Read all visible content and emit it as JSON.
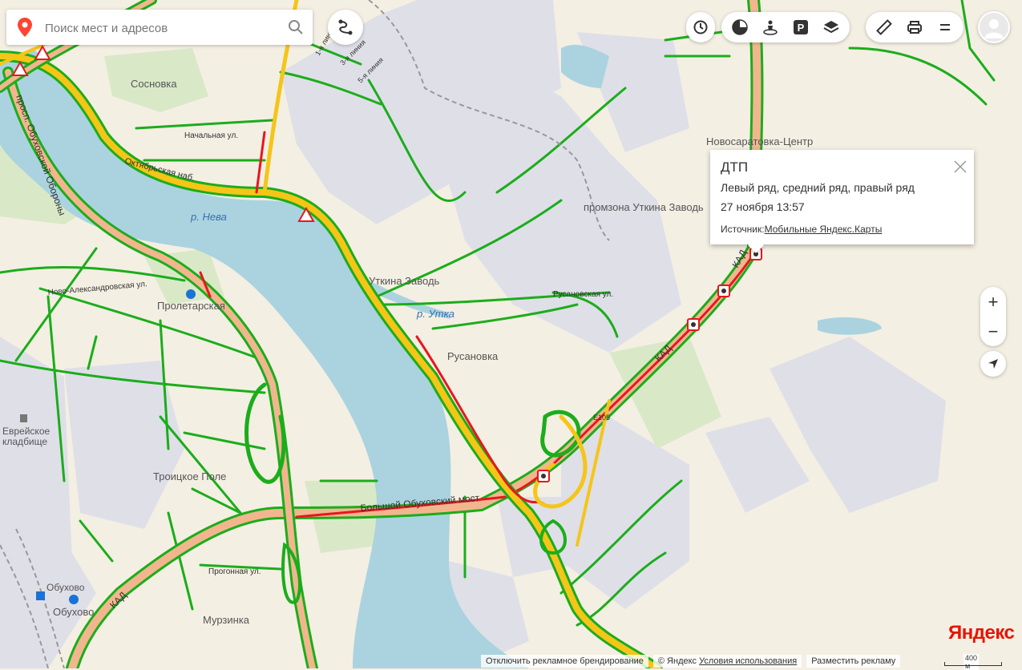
{
  "search": {
    "placeholder": "Поиск мест и адресов"
  },
  "labels": {
    "sosnovka": "Сосновка",
    "oktyabrskaya": "Октябрьская наб.",
    "neva": "р. Нева",
    "obukhovskoy": "просп. Обуховской Обороны",
    "proletarskaya": "Пролетарская",
    "novoalexandr": "Ново-Александровская ул.",
    "utkina": "Уткина Заводь",
    "utka": "р. Утка",
    "rusanovka": "Русановка",
    "promzona": "промзона Уткина Заводь",
    "novosaratovka": "Новосаратовка-Центр",
    "evreyskoe1": "Еврейское",
    "evreyskoe2": "кладбище",
    "troitskoe": "Троицкое Поле",
    "bolshoy": "Большой Обуховский мост",
    "kad": "КАД",
    "obukhovo": "Обухово",
    "murzinka": "Мурзинка",
    "progonnaya": "Прогонная ул.",
    "liniya1": "1-я линия",
    "liniya3": "3-я линия",
    "liniya5": "5-я линия",
    "rusanovskaya": "Русановская ул.",
    "e105": "E105",
    "ulitsa_nav": "Начальная ул."
  },
  "popup": {
    "title": "ДТП",
    "lanes": "Левый ряд, средний ряд, правый ряд",
    "datetime": "27 ноября 13:57",
    "source_label": "Источник:",
    "source_link": "Мобильные Яндекс.Карты"
  },
  "zoom": {
    "in": "+",
    "out": "−"
  },
  "logo": "Яндекс",
  "footer": {
    "branding": "Отключить рекламное брендирование",
    "copyright": "© Яндекс",
    "terms": "Условия использования",
    "ads": "Разместить рекламу"
  },
  "scale_label": "400 м",
  "colors": {
    "jam_green": "#1bad1b",
    "jam_yellow": "#f5c518",
    "jam_red": "#e8171e",
    "water": "#aad3df",
    "land": "#f4efe3",
    "industrial": "#dddde6",
    "park": "#d6e8c4"
  },
  "icons": [
    "map-pin-icon",
    "search-icon",
    "route-icon",
    "clock-icon",
    "traffic-icon",
    "panorama-icon",
    "parking-icon",
    "layers-icon",
    "ruler-icon",
    "print-icon",
    "menu-icon",
    "avatar-icon",
    "close-icon",
    "geolocation-icon",
    "accident-icon",
    "roadwork-icon"
  ]
}
